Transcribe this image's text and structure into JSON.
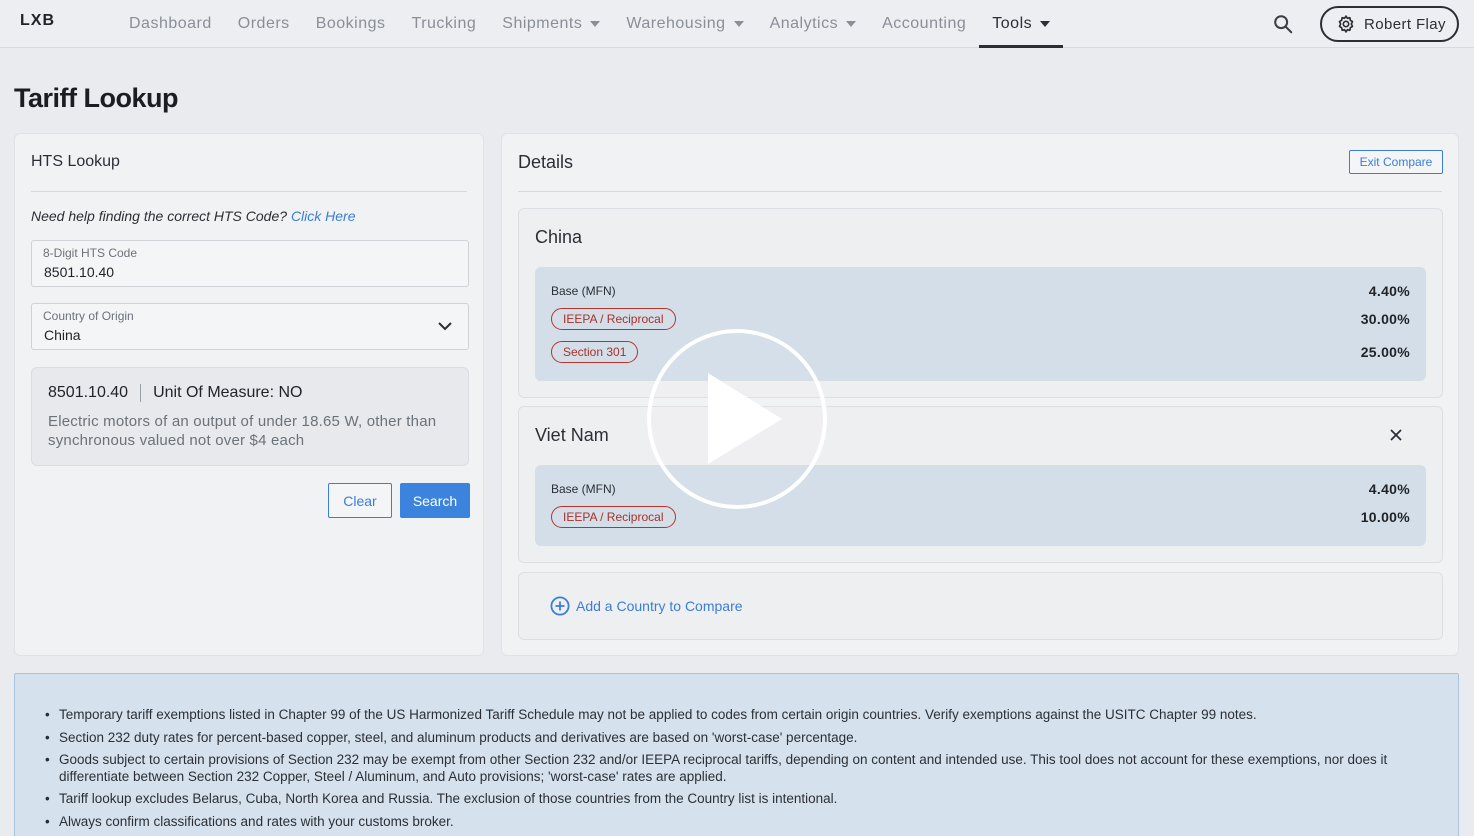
{
  "app": {
    "logo": "LXB"
  },
  "nav": {
    "items": [
      {
        "label": "Dashboard",
        "dropdown": false,
        "active": false
      },
      {
        "label": "Orders",
        "dropdown": false,
        "active": false
      },
      {
        "label": "Bookings",
        "dropdown": false,
        "active": false
      },
      {
        "label": "Trucking",
        "dropdown": false,
        "active": false
      },
      {
        "label": "Shipments",
        "dropdown": true,
        "active": false
      },
      {
        "label": "Warehousing",
        "dropdown": true,
        "active": false
      },
      {
        "label": "Analytics",
        "dropdown": true,
        "active": false
      },
      {
        "label": "Accounting",
        "dropdown": false,
        "active": false
      },
      {
        "label": "Tools",
        "dropdown": true,
        "active": true
      }
    ],
    "user_name": "Robert Flay"
  },
  "page": {
    "title": "Tariff Lookup"
  },
  "hts_lookup": {
    "title": "HTS Lookup",
    "help_text": "Need help finding the correct HTS Code?",
    "help_link": "Click Here",
    "code_field": {
      "label": "8-Digit HTS Code",
      "value": "8501.10.40"
    },
    "country_field": {
      "label": "Country of Origin",
      "value": "China"
    },
    "result": {
      "code": "8501.10.40",
      "unit": "Unit Of Measure: NO",
      "description": "Electric motors of an output of under 18.65 W, other than synchronous valued not over $4 each"
    },
    "clear_label": "Clear",
    "search_label": "Search"
  },
  "details": {
    "title": "Details",
    "exit_compare_label": "Exit Compare",
    "countries": [
      {
        "name": "China",
        "rates": [
          {
            "label": "Base (MFN)",
            "pill": false,
            "value": "4.40%"
          },
          {
            "label": "IEEPA / Reciprocal",
            "pill": true,
            "value": "30.00%"
          },
          {
            "label": "Section 301",
            "pill": true,
            "value": "25.00%"
          }
        ]
      },
      {
        "name": "Viet Nam",
        "rates": [
          {
            "label": "Base (MFN)",
            "pill": false,
            "value": "4.40%"
          },
          {
            "label": "IEEPA / Reciprocal",
            "pill": true,
            "value": "10.00%"
          }
        ]
      }
    ],
    "add_country_label": "Add a Country to Compare"
  },
  "notes": [
    "Temporary tariff exemptions listed in Chapter 99 of the US Harmonized Tariff Schedule may not be applied to codes from certain origin countries. Verify exemptions against the USITC Chapter 99 notes.",
    "Section 232 duty rates for percent-based copper, steel, and aluminum products and derivatives are based on 'worst-case' percentage.",
    "Goods subject to certain provisions of Section 232 may be exempt from other Section 232 and/or IEEPA reciprocal tariffs, depending on content and intended use. This tool does not account for these exemptions, nor does it differentiate between Section 232 Copper, Steel / Aluminum, and Auto provisions; 'worst-case' rates are applied.",
    "Tariff lookup excludes Belarus, Cuba, North Korea and Russia. The exclusion of those countries from the Country list is intentional.",
    "Always confirm classifications and rates with your customs broker."
  ],
  "colors": {
    "accent": "#3b7dd8",
    "pill_red": "#b8342a",
    "rate_bg": "#d3dee9",
    "notes_bg": "#d5e2ee"
  }
}
